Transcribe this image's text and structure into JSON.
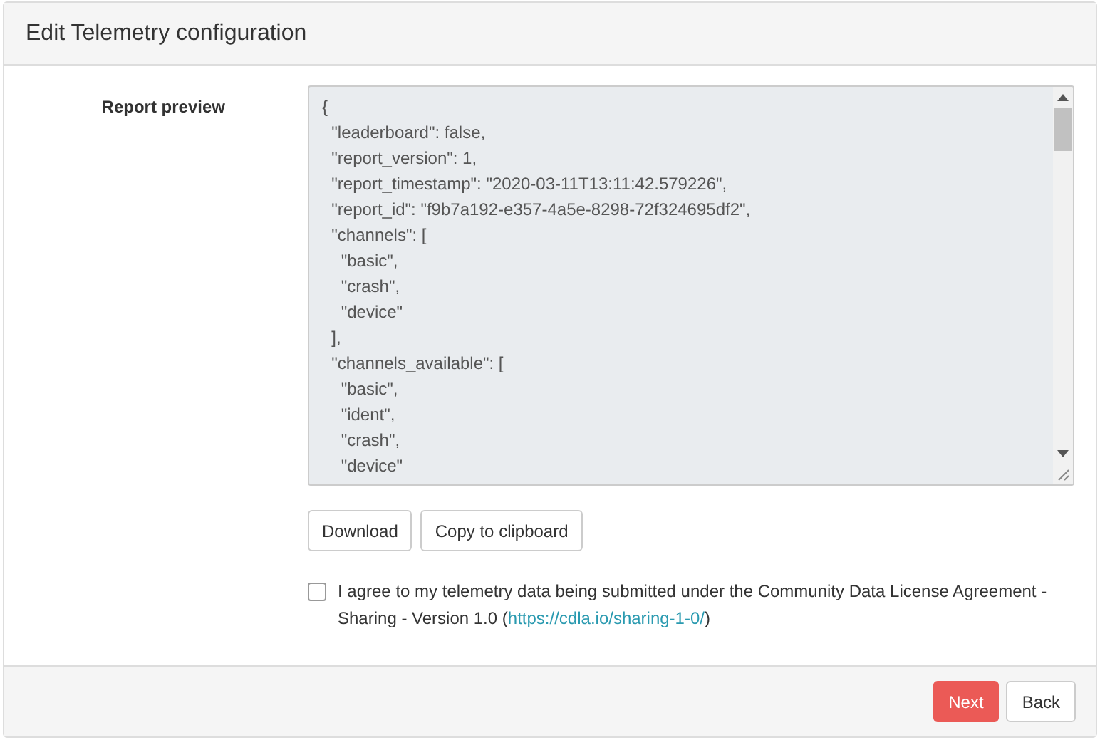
{
  "window": {
    "title": "Edit Telemetry configuration"
  },
  "report_preview": {
    "label": "Report preview",
    "lines": [
      "{",
      "  \"leaderboard\": false,",
      "  \"report_version\": 1,",
      "  \"report_timestamp\": \"2020-03-11T13:11:42.579226\",",
      "  \"report_id\": \"f9b7a192-e357-4a5e-8298-72f324695df2\",",
      "  \"channels\": [",
      "    \"basic\",",
      "    \"crash\",",
      "    \"device\"",
      "  ],",
      "  \"channels_available\": [",
      "    \"basic\",",
      "    \"ident\",",
      "    \"crash\",",
      "    \"device\""
    ]
  },
  "actions": [
    {
      "label": "Download"
    },
    {
      "label": "Copy to clipboard"
    }
  ],
  "agreement": {
    "checked": false,
    "text_before": "I agree to my telemetry data being submitted under the Community Data License Agreement - Sharing - Version 1.0 (",
    "link": "https://cdla.io/sharing-1-0/",
    "text_after": ")"
  },
  "footer_buttons": [
    {
      "label": "Next",
      "kind": "primary"
    },
    {
      "label": "Back",
      "kind": "default"
    }
  ]
}
